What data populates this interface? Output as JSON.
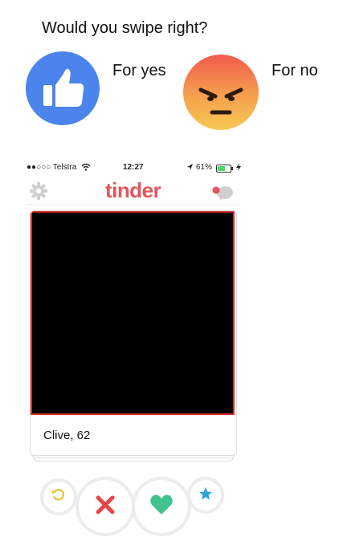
{
  "prompt": {
    "question": "Would you swipe right?",
    "yes_label": "For yes",
    "no_label": "For no",
    "yes_icon": "thumbs-up-icon",
    "no_icon": "angry-face-icon"
  },
  "status_bar": {
    "carrier": "●●○○○ Telstra",
    "time": "12:27",
    "battery": "61%",
    "battery_level": 0.61
  },
  "app": {
    "logo": "tinder",
    "brand_color": "#e3555d"
  },
  "profile": {
    "name_age": "Clive, 62"
  },
  "actions": [
    {
      "name": "rewind",
      "icon": "rewind-icon",
      "color": "#f0c23b"
    },
    {
      "name": "nope",
      "icon": "x-icon",
      "color": "#e5474b"
    },
    {
      "name": "like",
      "icon": "heart-icon",
      "color": "#42c28e"
    },
    {
      "name": "super-like",
      "icon": "star-icon",
      "color": "#2ea3d6"
    }
  ]
}
